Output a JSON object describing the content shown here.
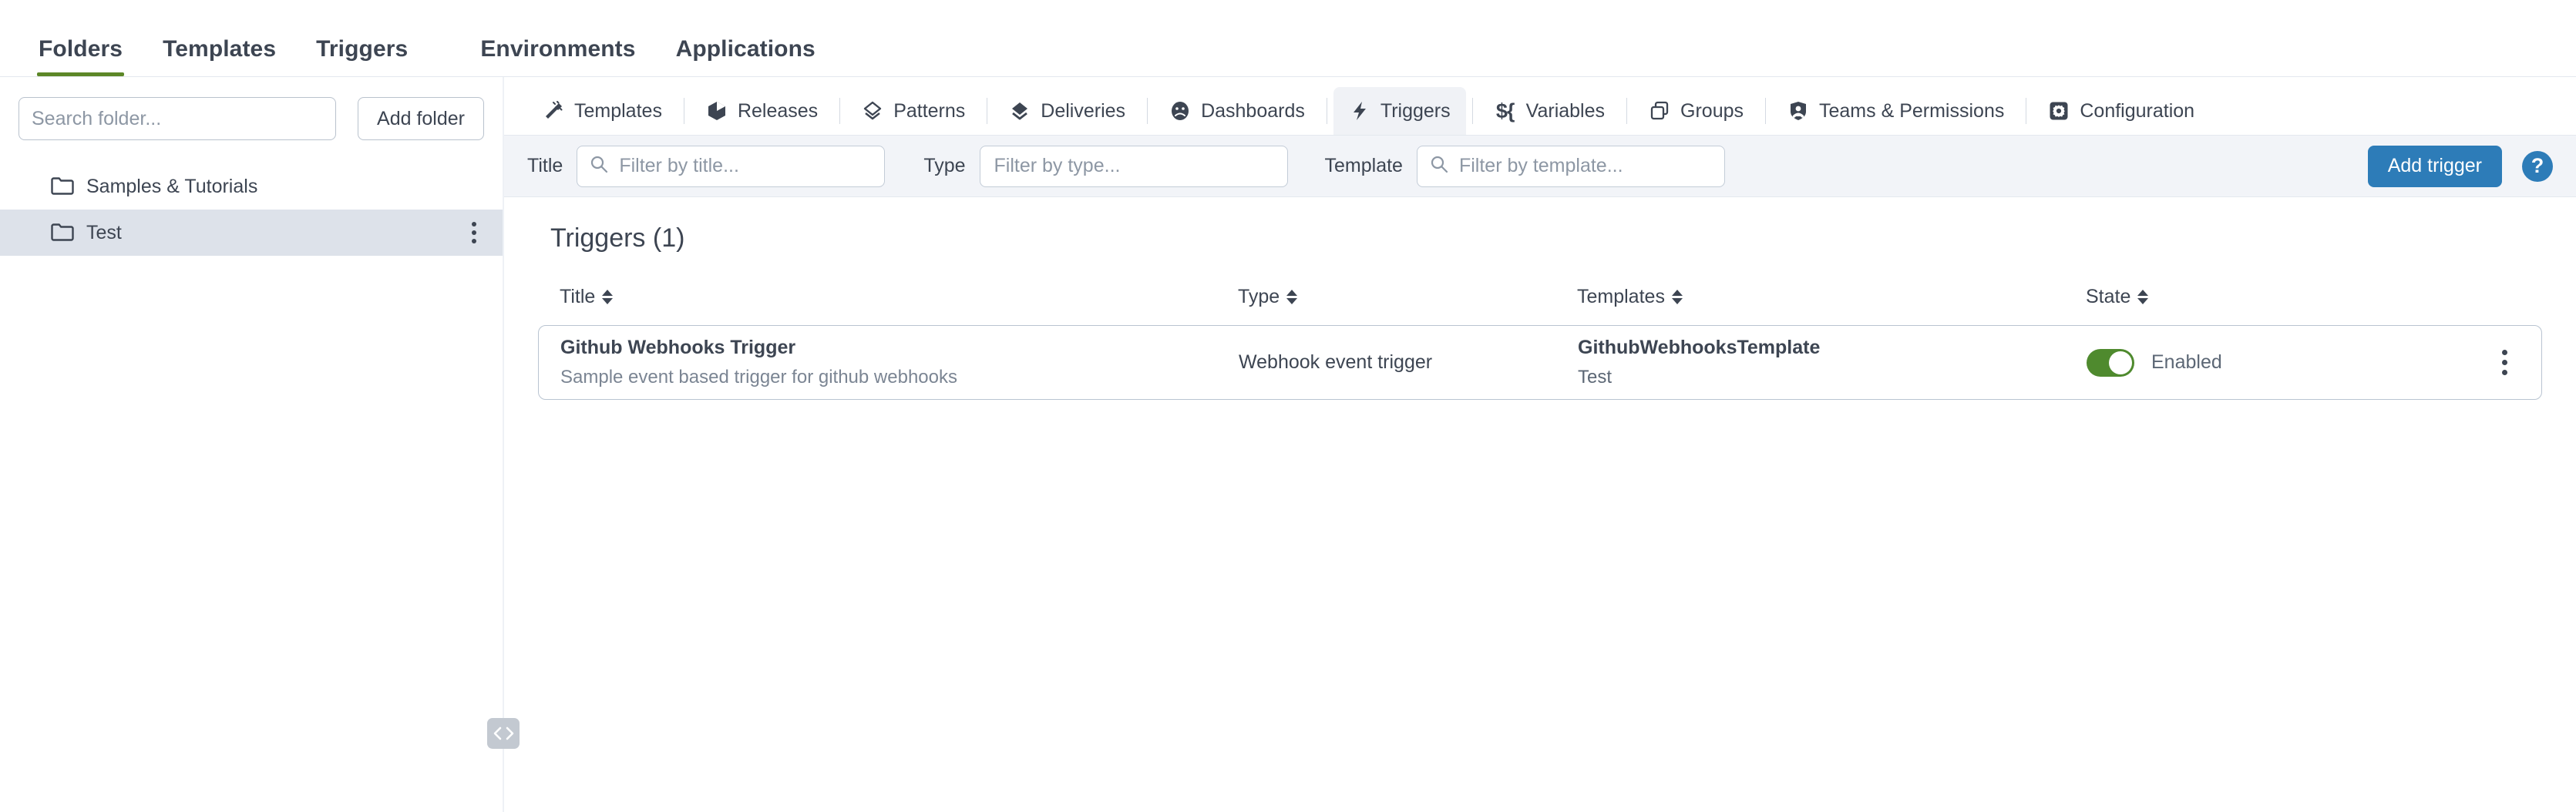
{
  "topnav": {
    "items": [
      {
        "label": "Folders",
        "active": true
      },
      {
        "label": "Templates",
        "active": false
      },
      {
        "label": "Triggers",
        "active": false
      },
      {
        "label": "Environments",
        "active": false
      },
      {
        "label": "Applications",
        "active": false
      }
    ],
    "accent_color": "#5c8727"
  },
  "sidebar": {
    "search": {
      "placeholder": "Search folder...",
      "value": ""
    },
    "add_folder_label": "Add folder",
    "folders": [
      {
        "label": "Samples & Tutorials",
        "icon": "folder-icon",
        "selected": false
      },
      {
        "label": "Test",
        "icon": "folder-icon",
        "selected": true
      }
    ],
    "splitter_icon": "collapse-expand-icon"
  },
  "subtabs": {
    "items": [
      {
        "label": "Templates",
        "icon": "templates-icon",
        "active": false
      },
      {
        "label": "Releases",
        "icon": "releases-icon",
        "active": false
      },
      {
        "label": "Patterns",
        "icon": "patterns-icon",
        "active": false
      },
      {
        "label": "Deliveries",
        "icon": "deliveries-icon",
        "active": false
      },
      {
        "label": "Dashboards",
        "icon": "dashboards-icon",
        "active": false
      },
      {
        "label": "Triggers",
        "icon": "triggers-icon",
        "active": true
      },
      {
        "label": "Variables",
        "icon": "variables-icon",
        "active": false
      },
      {
        "label": "Groups",
        "icon": "groups-icon",
        "active": false
      },
      {
        "label": "Teams & Permissions",
        "icon": "teams-permissions-icon",
        "active": false
      },
      {
        "label": "Configuration",
        "icon": "configuration-icon",
        "active": false
      }
    ]
  },
  "filterbar": {
    "title": {
      "label": "Title",
      "placeholder": "Filter by title...",
      "value": ""
    },
    "type": {
      "label": "Type",
      "placeholder": "Filter by type...",
      "value": ""
    },
    "template": {
      "label": "Template",
      "placeholder": "Filter by template...",
      "value": ""
    },
    "add_trigger_label": "Add trigger",
    "help_label": "?",
    "primary_color": "#2d7cb8"
  },
  "main": {
    "section_title": "Triggers (1)",
    "columns": [
      {
        "label": "Title"
      },
      {
        "label": "Type"
      },
      {
        "label": "Templates"
      },
      {
        "label": "State"
      }
    ],
    "rows": [
      {
        "title": "Github Webhooks Trigger",
        "description": "Sample event based trigger for github webhooks",
        "type": "Webhook event trigger",
        "template_name": "GithubWebhooksTemplate",
        "template_folder": "Test",
        "state_enabled": true,
        "state_label": "Enabled",
        "state_color": "#4f8a2e"
      }
    ]
  }
}
